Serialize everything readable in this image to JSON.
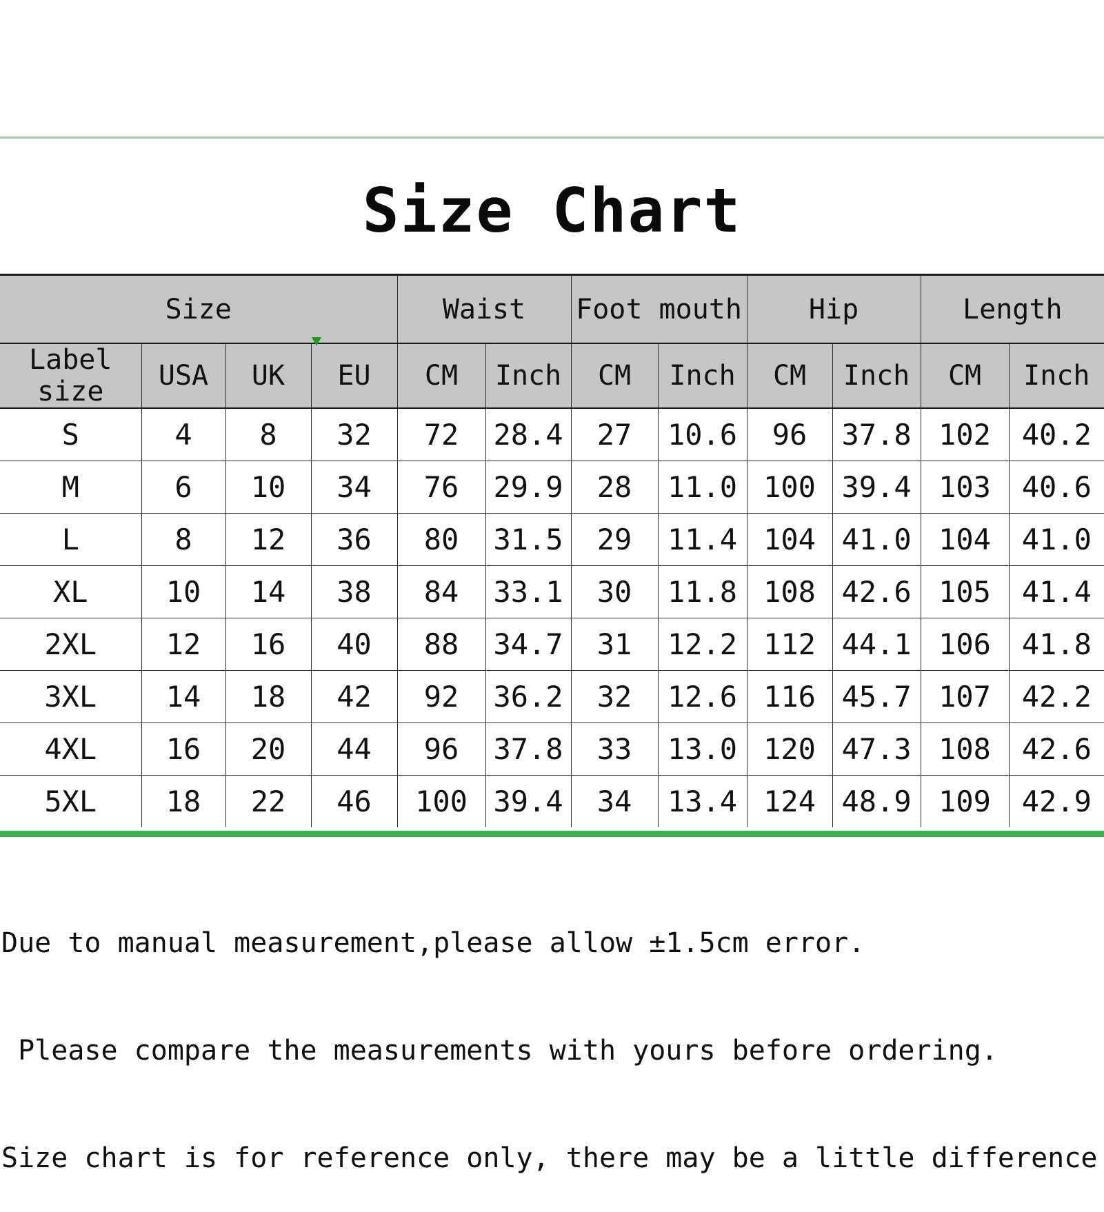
{
  "title": "Size Chart",
  "colors": {
    "header_bg": "#C6C6C6",
    "top_rule": "#9ECB9C",
    "bottom_rule": "#3EB24A",
    "grid_line": "#2B2B2B",
    "text": "#111111",
    "green_tick": "#17A01B"
  },
  "table": {
    "group_headers": [
      {
        "label": "Size",
        "span": 4
      },
      {
        "label": "Waist",
        "span": 2
      },
      {
        "label": "Foot mouth",
        "span": 2
      },
      {
        "label": "Hip",
        "span": 2
      },
      {
        "label": "Length",
        "span": 2
      }
    ],
    "unit_headers": [
      "Label size",
      "USA",
      "UK",
      "EU",
      "CM",
      "Inch",
      "CM",
      "Inch",
      "CM",
      "Inch",
      "CM",
      "Inch"
    ],
    "rows": [
      [
        "S",
        "4",
        "8",
        "32",
        "72",
        "28.4",
        "27",
        "10.6",
        "96",
        "37.8",
        "102",
        "40.2"
      ],
      [
        "M",
        "6",
        "10",
        "34",
        "76",
        "29.9",
        "28",
        "11.0",
        "100",
        "39.4",
        "103",
        "40.6"
      ],
      [
        "L",
        "8",
        "12",
        "36",
        "80",
        "31.5",
        "29",
        "11.4",
        "104",
        "41.0",
        "104",
        "41.0"
      ],
      [
        "XL",
        "10",
        "14",
        "38",
        "84",
        "33.1",
        "30",
        "11.8",
        "108",
        "42.6",
        "105",
        "41.4"
      ],
      [
        "2XL",
        "12",
        "16",
        "40",
        "88",
        "34.7",
        "31",
        "12.2",
        "112",
        "44.1",
        "106",
        "41.8"
      ],
      [
        "3XL",
        "14",
        "18",
        "42",
        "92",
        "36.2",
        "32",
        "12.6",
        "116",
        "45.7",
        "107",
        "42.2"
      ],
      [
        "4XL",
        "16",
        "20",
        "44",
        "96",
        "37.8",
        "33",
        "13.0",
        "120",
        "47.3",
        "108",
        "42.6"
      ],
      [
        "5XL",
        "18",
        "22",
        "46",
        "100",
        "39.4",
        "34",
        "13.4",
        "124",
        "48.9",
        "109",
        "42.9"
      ]
    ]
  },
  "notes": [
    "Due to manual measurement,please allow ±1.5cm error.",
    " Please compare the measurements with yours before ordering.",
    "Size chart is for reference only, there may be a little difference with what you get."
  ],
  "chart_data": {
    "type": "table",
    "title": "Size Chart",
    "columns": [
      "Label size",
      "USA",
      "UK",
      "EU",
      "Waist CM",
      "Waist Inch",
      "Foot mouth CM",
      "Foot mouth Inch",
      "Hip CM",
      "Hip Inch",
      "Length CM",
      "Length Inch"
    ],
    "rows": [
      [
        "S",
        4,
        8,
        32,
        72,
        28.4,
        27,
        10.6,
        96,
        37.8,
        102,
        40.2
      ],
      [
        "M",
        6,
        10,
        34,
        76,
        29.9,
        28,
        11.0,
        100,
        39.4,
        103,
        40.6
      ],
      [
        "L",
        8,
        12,
        36,
        80,
        31.5,
        29,
        11.4,
        104,
        41.0,
        104,
        41.0
      ],
      [
        "XL",
        10,
        14,
        38,
        84,
        33.1,
        30,
        11.8,
        108,
        42.6,
        105,
        41.4
      ],
      [
        "2XL",
        12,
        16,
        40,
        88,
        34.7,
        31,
        12.2,
        112,
        44.1,
        106,
        41.8
      ],
      [
        "3XL",
        14,
        18,
        42,
        92,
        36.2,
        32,
        12.6,
        116,
        45.7,
        107,
        42.2
      ],
      [
        "4XL",
        16,
        20,
        44,
        96,
        37.8,
        33,
        13.0,
        120,
        47.3,
        108,
        42.6
      ],
      [
        "5XL",
        18,
        22,
        46,
        100,
        39.4,
        34,
        13.4,
        124,
        48.9,
        109,
        42.9
      ]
    ]
  }
}
